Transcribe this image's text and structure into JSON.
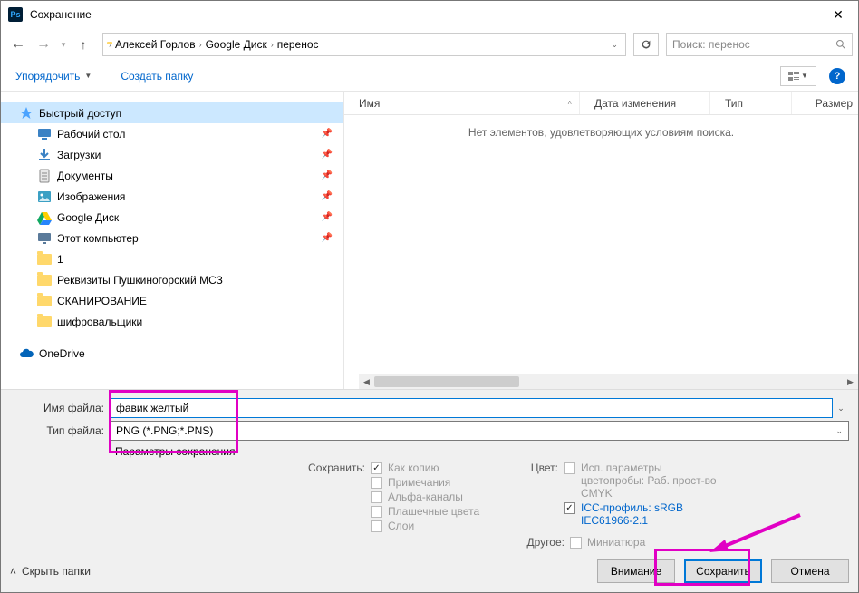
{
  "titlebar": {
    "title": "Сохранение"
  },
  "breadcrumb": {
    "segs": [
      "Алексей Горлов",
      "Google Диск",
      "перенос"
    ]
  },
  "search": {
    "placeholder": "Поиск: перенос"
  },
  "toolbar": {
    "organize": "Упорядочить",
    "newfolder": "Создать папку"
  },
  "tree": {
    "quick": "Быстрый доступ",
    "items": [
      {
        "label": "Рабочий стол",
        "pin": true,
        "icon": "desktop"
      },
      {
        "label": "Загрузки",
        "pin": true,
        "icon": "downloads"
      },
      {
        "label": "Документы",
        "pin": true,
        "icon": "documents"
      },
      {
        "label": "Изображения",
        "pin": true,
        "icon": "pictures"
      },
      {
        "label": "Google Диск",
        "pin": true,
        "icon": "gdrive"
      },
      {
        "label": "Этот компьютер",
        "pin": true,
        "icon": "pc"
      },
      {
        "label": "1",
        "pin": false,
        "icon": "folder"
      },
      {
        "label": "Реквизиты Пушкиногорский МСЗ",
        "pin": false,
        "icon": "folder"
      },
      {
        "label": "СКАНИРОВАНИЕ",
        "pin": false,
        "icon": "folder"
      },
      {
        "label": "шифровальщики",
        "pin": false,
        "icon": "folder"
      }
    ],
    "onedrive": "OneDrive"
  },
  "columns": {
    "name": "Имя",
    "date": "Дата изменения",
    "type": "Тип",
    "size": "Размер"
  },
  "empty": "Нет элементов, удовлетворяющих условиям поиска.",
  "form": {
    "filename_label": "Имя файла:",
    "filename_value": "фавик желтый",
    "filetype_label": "Тип файла:",
    "filetype_value": "PNG (*.PNG;*.PNS)",
    "save_params": "Параметры сохранения"
  },
  "options": {
    "save_label": "Сохранить:",
    "as_copy": "Как копию",
    "notes": "Примечания",
    "alpha": "Альфа-каналы",
    "spot": "Плашечные цвета",
    "layers": "Слои",
    "color_label": "Цвет:",
    "proof": "Исп. параметры цветопробы:  Раб. прост-во CMYK",
    "icc": "ICC-профиль:  sRGB IEC61966-2.1",
    "other_label": "Другое:",
    "thumb": "Миниатюра"
  },
  "actions": {
    "hide": "Скрыть папки",
    "attention": "Внимание",
    "save": "Сохранить",
    "cancel": "Отмена"
  }
}
